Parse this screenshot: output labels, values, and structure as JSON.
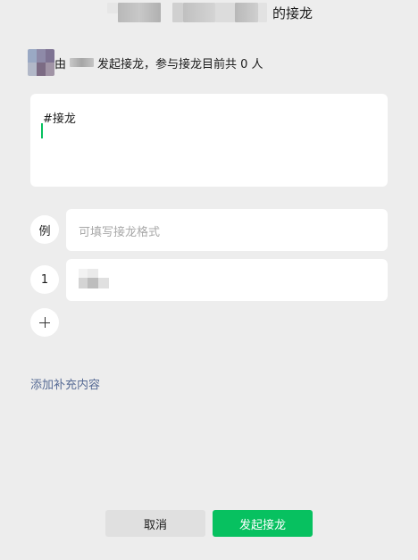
{
  "header": {
    "title_suffix": "的接龙"
  },
  "initiator": {
    "prefix": "由",
    "message": "发起接龙，参与接龙目前共 0 人"
  },
  "text_card": {
    "content": "#接龙"
  },
  "example_row": {
    "badge": "例",
    "placeholder": "可填写接龙格式"
  },
  "entry_row": {
    "badge": "1"
  },
  "add_supplement": {
    "label": "添加补充内容"
  },
  "buttons": {
    "cancel": "取消",
    "submit": "发起接龙"
  },
  "colors": {
    "accent_green": "#07c160",
    "link_blue": "#576b95",
    "background": "#ededed"
  },
  "icons": {
    "add": "plus-icon"
  }
}
